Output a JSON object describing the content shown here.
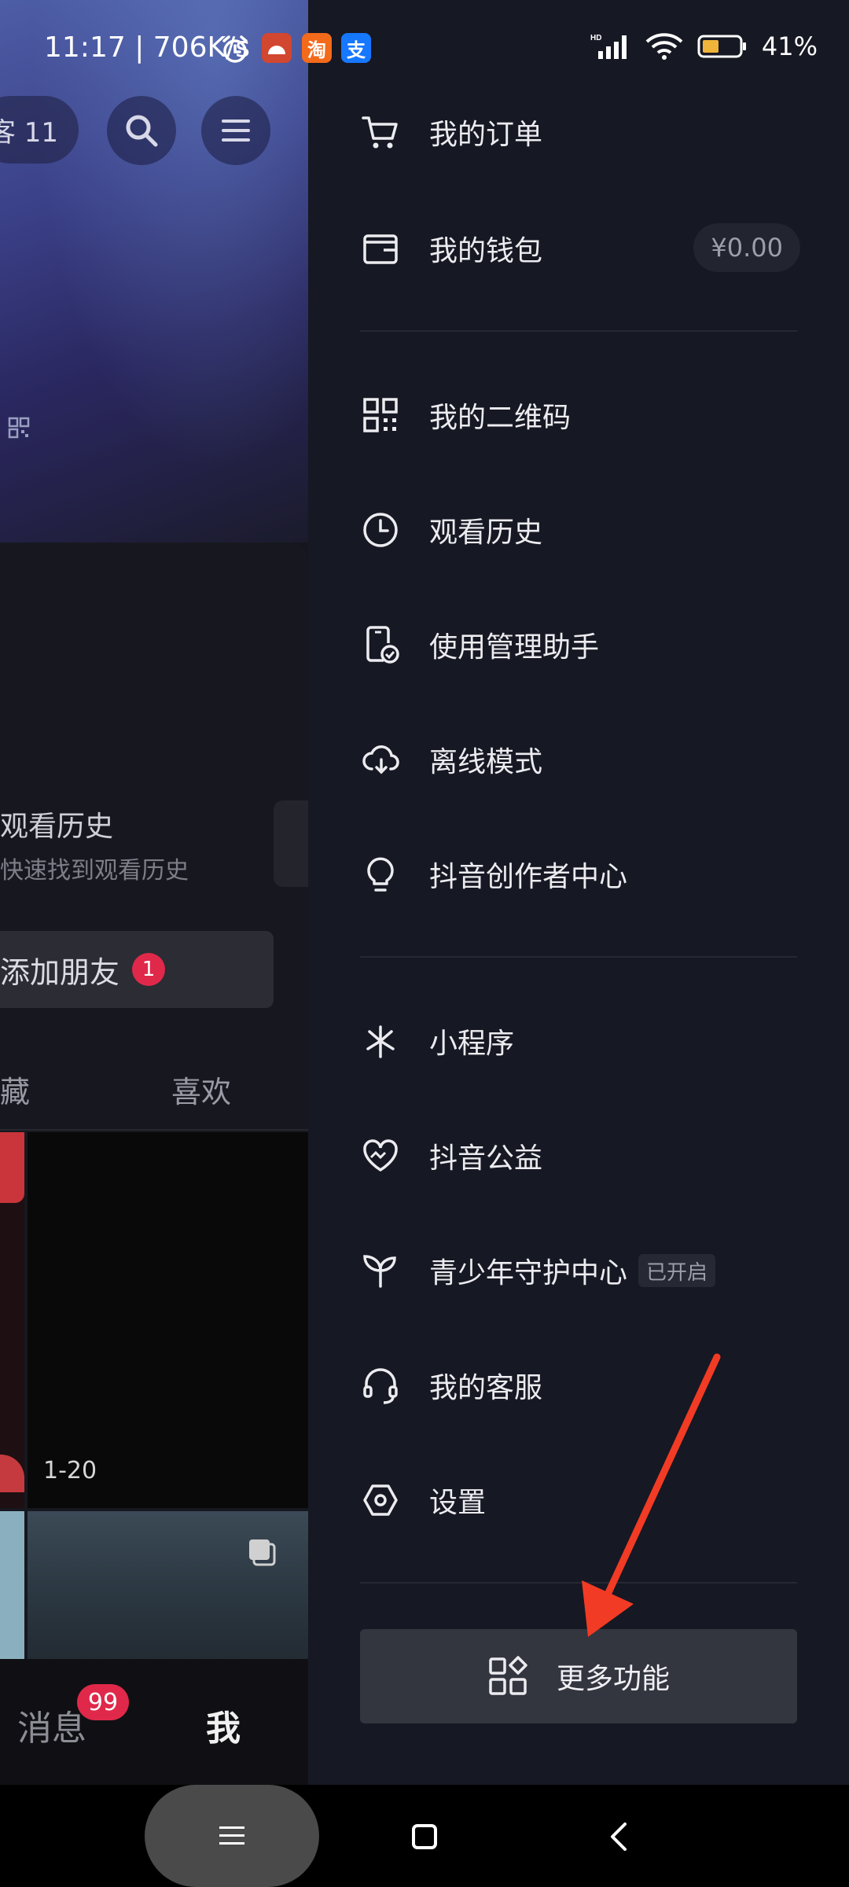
{
  "status_bar": {
    "time_speed": "11:17 | 706K/s",
    "app_icons": [
      {
        "name": "alarm-icon",
        "text": ""
      },
      {
        "name": "game-app-icon",
        "text": "",
        "color": "#d2472f"
      },
      {
        "name": "taobao-app-icon",
        "text": "淘",
        "color": "#f36a1b"
      },
      {
        "name": "alipay-app-icon",
        "text": "支",
        "color": "#1677ff"
      }
    ],
    "network_badge": "HD",
    "battery_percent": "41%"
  },
  "profile_bg": {
    "visitor_text": "客 11",
    "history_title": "观看历史",
    "history_subtitle": "快速找到观看历史",
    "add_friend_label": "添加朋友",
    "add_friend_badge": "1",
    "tab_collect": "藏",
    "tab_like": "喜欢",
    "video_count": "1-20",
    "nav_messages": "消息",
    "nav_messages_badge": "99",
    "nav_me": "我"
  },
  "drawer": {
    "group1": [
      {
        "label": "我的订单",
        "icon": "cart-icon"
      },
      {
        "label": "我的钱包",
        "icon": "wallet-icon",
        "value": "¥0.00"
      }
    ],
    "group2": [
      {
        "label": "我的二维码",
        "icon": "qr-code-icon"
      },
      {
        "label": "观看历史",
        "icon": "clock-icon"
      },
      {
        "label": "使用管理助手",
        "icon": "phone-check-icon"
      },
      {
        "label": "离线模式",
        "icon": "cloud-download-icon"
      },
      {
        "label": "抖音创作者中心",
        "icon": "lightbulb-icon"
      }
    ],
    "group3": [
      {
        "label": "小程序",
        "icon": "mini-program-icon"
      },
      {
        "label": "抖音公益",
        "icon": "heart-icon"
      },
      {
        "label": "青少年守护中心",
        "icon": "sprout-icon",
        "tag": "已开启"
      },
      {
        "label": "我的客服",
        "icon": "headset-icon"
      },
      {
        "label": "设置",
        "icon": "settings-icon"
      }
    ],
    "more_button": "更多功能"
  },
  "annotation": {
    "color": "#f23b24"
  }
}
